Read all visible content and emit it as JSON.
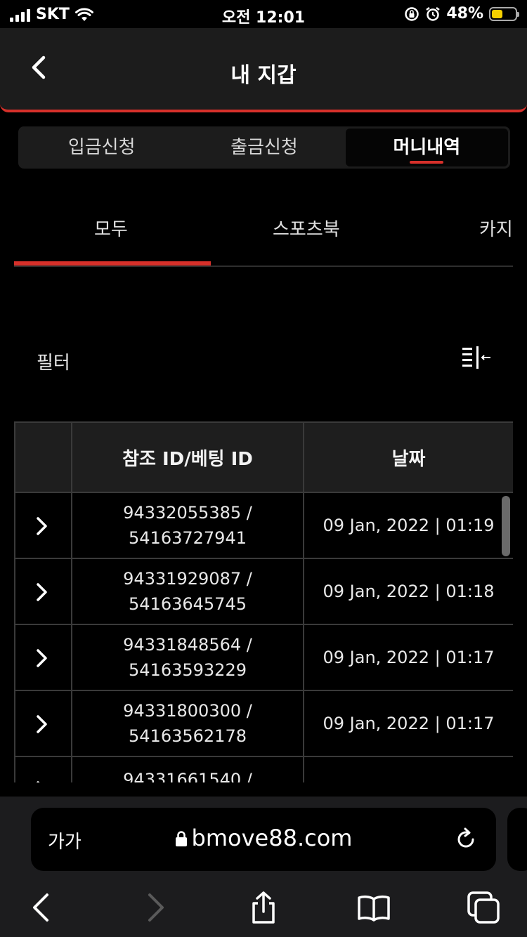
{
  "status_bar": {
    "carrier": "SKT",
    "time": "오전 12:01",
    "battery": "48%",
    "battery_level": 0.48,
    "battery_color": "#f5d000"
  },
  "header": {
    "title": "내 지갑",
    "back_icon": "chevron-left-icon",
    "accent_color": "#d6302a"
  },
  "segment_tabs": [
    {
      "label": "입금신청",
      "active": false
    },
    {
      "label": "출금신청",
      "active": false
    },
    {
      "label": "머니내역",
      "active": true
    }
  ],
  "sub_tabs": [
    {
      "label": "모두",
      "active": true
    },
    {
      "label": "스포츠북",
      "active": false
    },
    {
      "label": "카지",
      "active": false
    }
  ],
  "filter": {
    "label": "필터",
    "icon": "filter-collapse-icon"
  },
  "table": {
    "headers": [
      "",
      "참조 ID/베팅 ID",
      "날짜"
    ],
    "rows": [
      {
        "ref_id": "94332055385 /",
        "bet_id": "54163727941",
        "date": "09 Jan, 2022 | 01:19"
      },
      {
        "ref_id": "94331929087 /",
        "bet_id": "54163645745",
        "date": "09 Jan, 2022 | 01:18"
      },
      {
        "ref_id": "94331848564 /",
        "bet_id": "54163593229",
        "date": "09 Jan, 2022 | 01:17"
      },
      {
        "ref_id": "94331800300 /",
        "bet_id": "54163562178",
        "date": "09 Jan, 2022 | 01:17"
      },
      {
        "ref_id": "94331661540 /",
        "bet_id": "",
        "date": ""
      }
    ]
  },
  "browser": {
    "text_size_label": "가가",
    "url": "bmove88.com"
  }
}
